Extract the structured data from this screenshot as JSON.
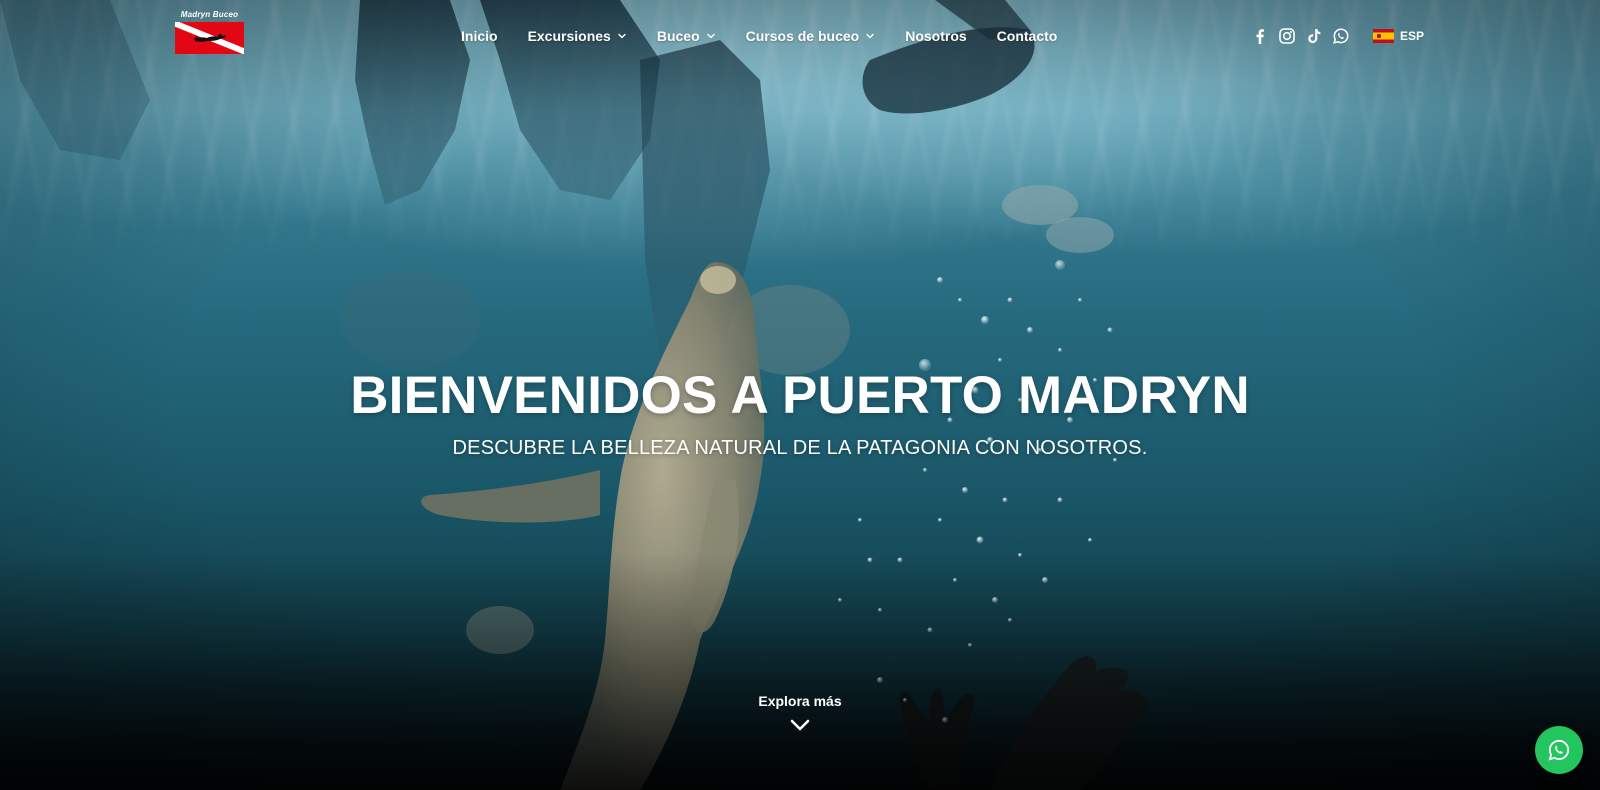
{
  "brand": {
    "logo_text": "Madryn Buceo",
    "logo_colors": {
      "flag_red": "#e30613",
      "stripe": "#ffffff"
    }
  },
  "nav": {
    "items": [
      {
        "label": "Inicio",
        "has_dropdown": false
      },
      {
        "label": "Excursiones",
        "has_dropdown": true
      },
      {
        "label": "Buceo",
        "has_dropdown": true
      },
      {
        "label": "Cursos de buceo",
        "has_dropdown": true
      },
      {
        "label": "Nosotros",
        "has_dropdown": false
      },
      {
        "label": "Contacto",
        "has_dropdown": false
      }
    ]
  },
  "socials": [
    {
      "name": "facebook-icon"
    },
    {
      "name": "instagram-icon"
    },
    {
      "name": "tiktok-icon"
    },
    {
      "name": "whatsapp-icon"
    }
  ],
  "language": {
    "label": "ESP",
    "flag": "spain-flag-icon"
  },
  "hero": {
    "title": "BIENVENIDOS A PUERTO MADRYN",
    "subtitle": "DESCUBRE LA BELLEZA NATURAL DE LA PATAGONIA CON NOSOTROS.",
    "explore_label": "Explora más",
    "explore_icon": "chevron-down-icon"
  },
  "floating": {
    "whatsapp_icon": "whatsapp-icon",
    "color": "#23c55e"
  }
}
